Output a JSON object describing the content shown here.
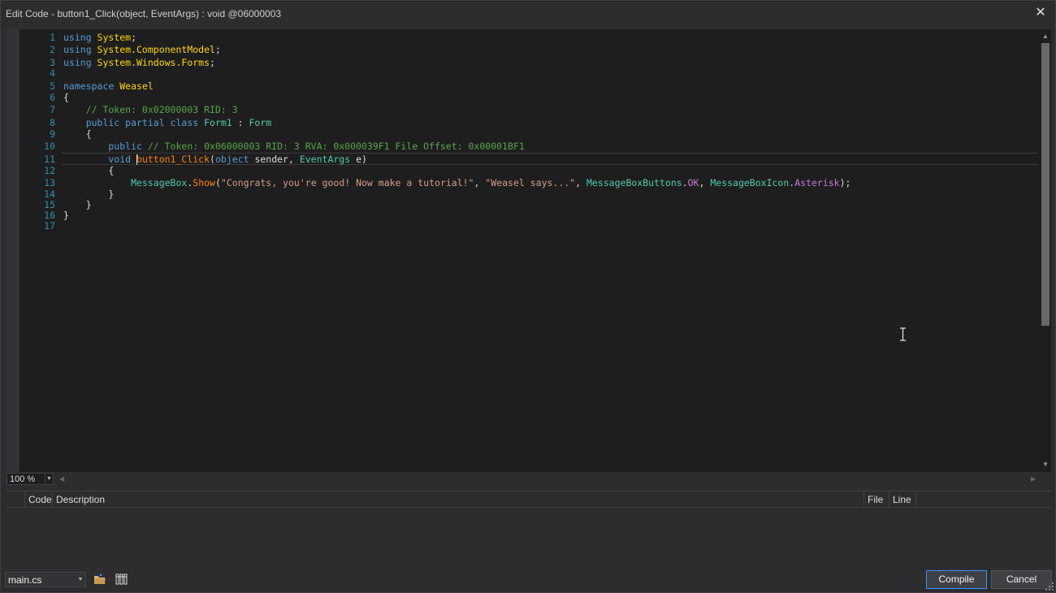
{
  "window": {
    "title": "Edit Code - button1_Click(object, EventArgs) : void @06000003",
    "close_glyph": "✕"
  },
  "editor": {
    "line_numbers": [
      "1",
      "2",
      "3",
      "4",
      "5",
      "6",
      "7",
      "8",
      "9",
      "10",
      "11",
      "12",
      "13",
      "14",
      "15",
      "16",
      "17"
    ],
    "lines": [
      [
        {
          "t": "using ",
          "c": "kw"
        },
        {
          "t": "System",
          "c": "ty"
        },
        {
          "t": ";",
          "c": ""
        }
      ],
      [
        {
          "t": "using ",
          "c": "kw"
        },
        {
          "t": "System.ComponentModel",
          "c": "ty"
        },
        {
          "t": ";",
          "c": ""
        }
      ],
      [
        {
          "t": "using ",
          "c": "kw"
        },
        {
          "t": "System.Windows.Forms",
          "c": "ty"
        },
        {
          "t": ";",
          "c": ""
        }
      ],
      [],
      [
        {
          "t": "namespace ",
          "c": "kw"
        },
        {
          "t": "Weasel",
          "c": "ty"
        }
      ],
      [
        {
          "t": "{",
          "c": ""
        }
      ],
      [
        {
          "t": "    // Token: 0x02000003 RID: 3",
          "c": "cmt"
        }
      ],
      [
        {
          "t": "    public partial class ",
          "c": "kw"
        },
        {
          "t": "Form1",
          "c": "cls"
        },
        {
          "t": " : ",
          "c": ""
        },
        {
          "t": "Form",
          "c": "cls"
        }
      ],
      [
        {
          "t": "    {",
          "c": ""
        }
      ],
      [
        {
          "t": "        public ",
          "c": "kw"
        },
        {
          "t": "// Token: 0x06000003 RID: 3 RVA: 0x000039F1 File Offset: 0x00001BF1",
          "c": "cmt"
        }
      ],
      [
        {
          "t": "        void ",
          "c": "kw"
        },
        {
          "t": "button1_Click",
          "c": "mth"
        },
        {
          "t": "(",
          "c": ""
        },
        {
          "t": "object",
          "c": "kw"
        },
        {
          "t": " sender, ",
          "c": ""
        },
        {
          "t": "EventArgs",
          "c": "cls"
        },
        {
          "t": " e)",
          "c": ""
        }
      ],
      [
        {
          "t": "        {",
          "c": ""
        }
      ],
      [
        {
          "t": "            ",
          "c": ""
        },
        {
          "t": "MessageBox",
          "c": "cls"
        },
        {
          "t": ".",
          "c": ""
        },
        {
          "t": "Show",
          "c": "mth"
        },
        {
          "t": "(",
          "c": ""
        },
        {
          "t": "\"Congrats, you're good! Now make a tutorial!\"",
          "c": "str"
        },
        {
          "t": ", ",
          "c": ""
        },
        {
          "t": "\"Weasel says...\"",
          "c": "str"
        },
        {
          "t": ", ",
          "c": ""
        },
        {
          "t": "MessageBoxButtons",
          "c": "cls"
        },
        {
          "t": ".",
          "c": ""
        },
        {
          "t": "OK",
          "c": "prop"
        },
        {
          "t": ", ",
          "c": ""
        },
        {
          "t": "MessageBoxIcon",
          "c": "cls"
        },
        {
          "t": ".",
          "c": ""
        },
        {
          "t": "Asterisk",
          "c": "prop"
        },
        {
          "t": ");",
          "c": ""
        }
      ],
      [
        {
          "t": "        }",
          "c": ""
        }
      ],
      [
        {
          "t": "    }",
          "c": ""
        }
      ],
      [
        {
          "t": "}",
          "c": ""
        }
      ],
      []
    ],
    "current_line": 11,
    "zoom": "100 %"
  },
  "error_list": {
    "columns": [
      "Code",
      "Description",
      "File",
      "Line"
    ]
  },
  "bottom": {
    "file": "main.cs",
    "compile_label": "Compile",
    "cancel_label": "Cancel"
  },
  "colors": {
    "background": "#2d2d30",
    "editor": "#1e1e1e",
    "keyword": "#569cd6",
    "type": "#ffd700",
    "class": "#4ec9b0",
    "comment": "#57a64a",
    "method": "#ff8000",
    "string": "#d69d85",
    "accent": "#3399ff"
  }
}
